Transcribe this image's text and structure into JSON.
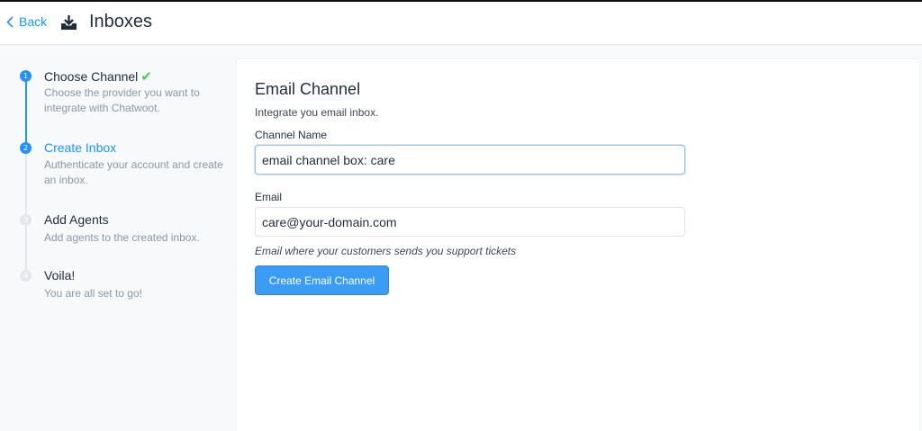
{
  "header": {
    "back_label": "Back",
    "title": "Inboxes",
    "icon": "inbox-download-icon"
  },
  "steps": [
    {
      "number": "1",
      "title": "Choose Channel",
      "description": "Choose the provider you want to integrate with Chatwoot.",
      "state": "completed"
    },
    {
      "number": "2",
      "title": "Create Inbox",
      "description": "Authenticate your account and create an inbox.",
      "state": "current"
    },
    {
      "number": "3",
      "title": "Add Agents",
      "description": "Add agents to the created inbox.",
      "state": "pending"
    },
    {
      "number": "4",
      "title": "Voila!",
      "description": "You are all set to go!",
      "state": "pending"
    }
  ],
  "form": {
    "title": "Email Channel",
    "subtitle": "Integrate you email inbox.",
    "channel_name_label": "Channel Name",
    "channel_name_value": "email channel box: care",
    "email_label": "Email",
    "email_value": "care@your-domain.com",
    "email_help": "Email where your customers sends you support tickets",
    "submit_label": "Create Email Channel"
  },
  "colors": {
    "accent": "#1f93ff",
    "success": "#44ce4b",
    "button": "#3b9cf5"
  }
}
